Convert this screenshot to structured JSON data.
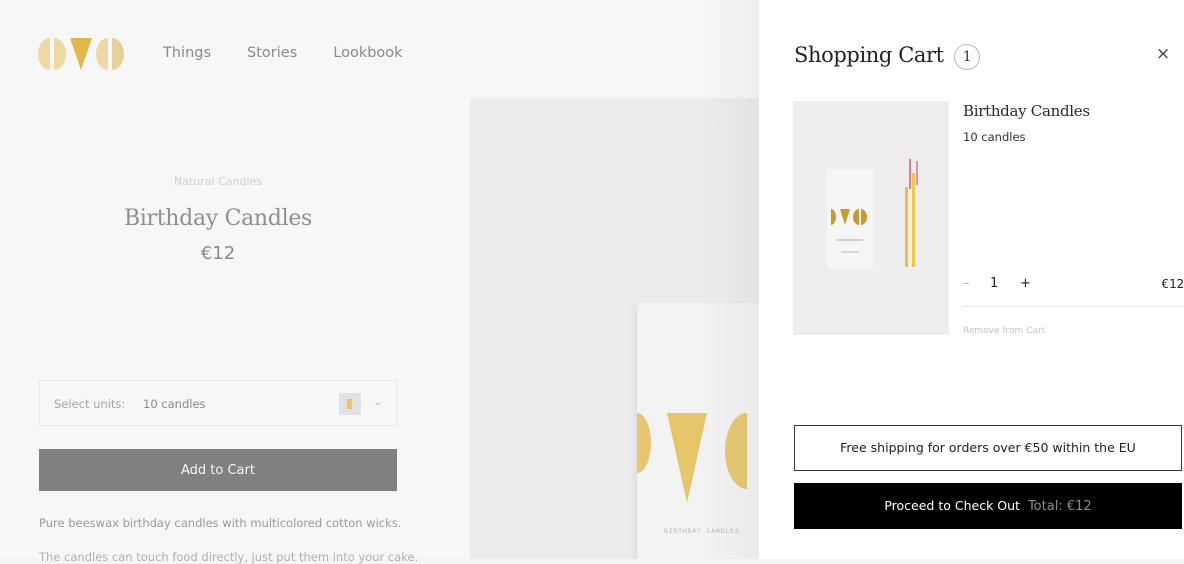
{
  "nav": {
    "items": [
      "Things",
      "Stories",
      "Lookbook"
    ]
  },
  "product": {
    "category": "Natural Candles",
    "title": "Birthday Candles",
    "price": "€12",
    "select_label": "Select units:",
    "select_value": "10 candles",
    "add_to_cart_label": "Add to Cart",
    "description_1": "Pure beeswax birthday candles with multicolored cotton wicks.",
    "description_2": "The candles can touch food directly, just put them into your cake.",
    "box_text": "BIRTHDAY CANDLES"
  },
  "cart": {
    "title": "Shopping Cart",
    "count": "1",
    "close_glyph": "×",
    "item": {
      "name": "Birthday Candles",
      "variant": "10 candles",
      "qty_minus": "–",
      "quantity": "1",
      "qty_plus": "+",
      "price": "€12",
      "remove_label": "Remove from Cart"
    },
    "shipping_notice": "Free shipping for orders over €50 within the EU",
    "checkout_label": "Proceed to Check Out",
    "total_label": "Total: €12"
  },
  "colors": {
    "accent_gold": "#e3b84a",
    "checkout_bg": "#000000",
    "add_button_bg": "#808080"
  }
}
